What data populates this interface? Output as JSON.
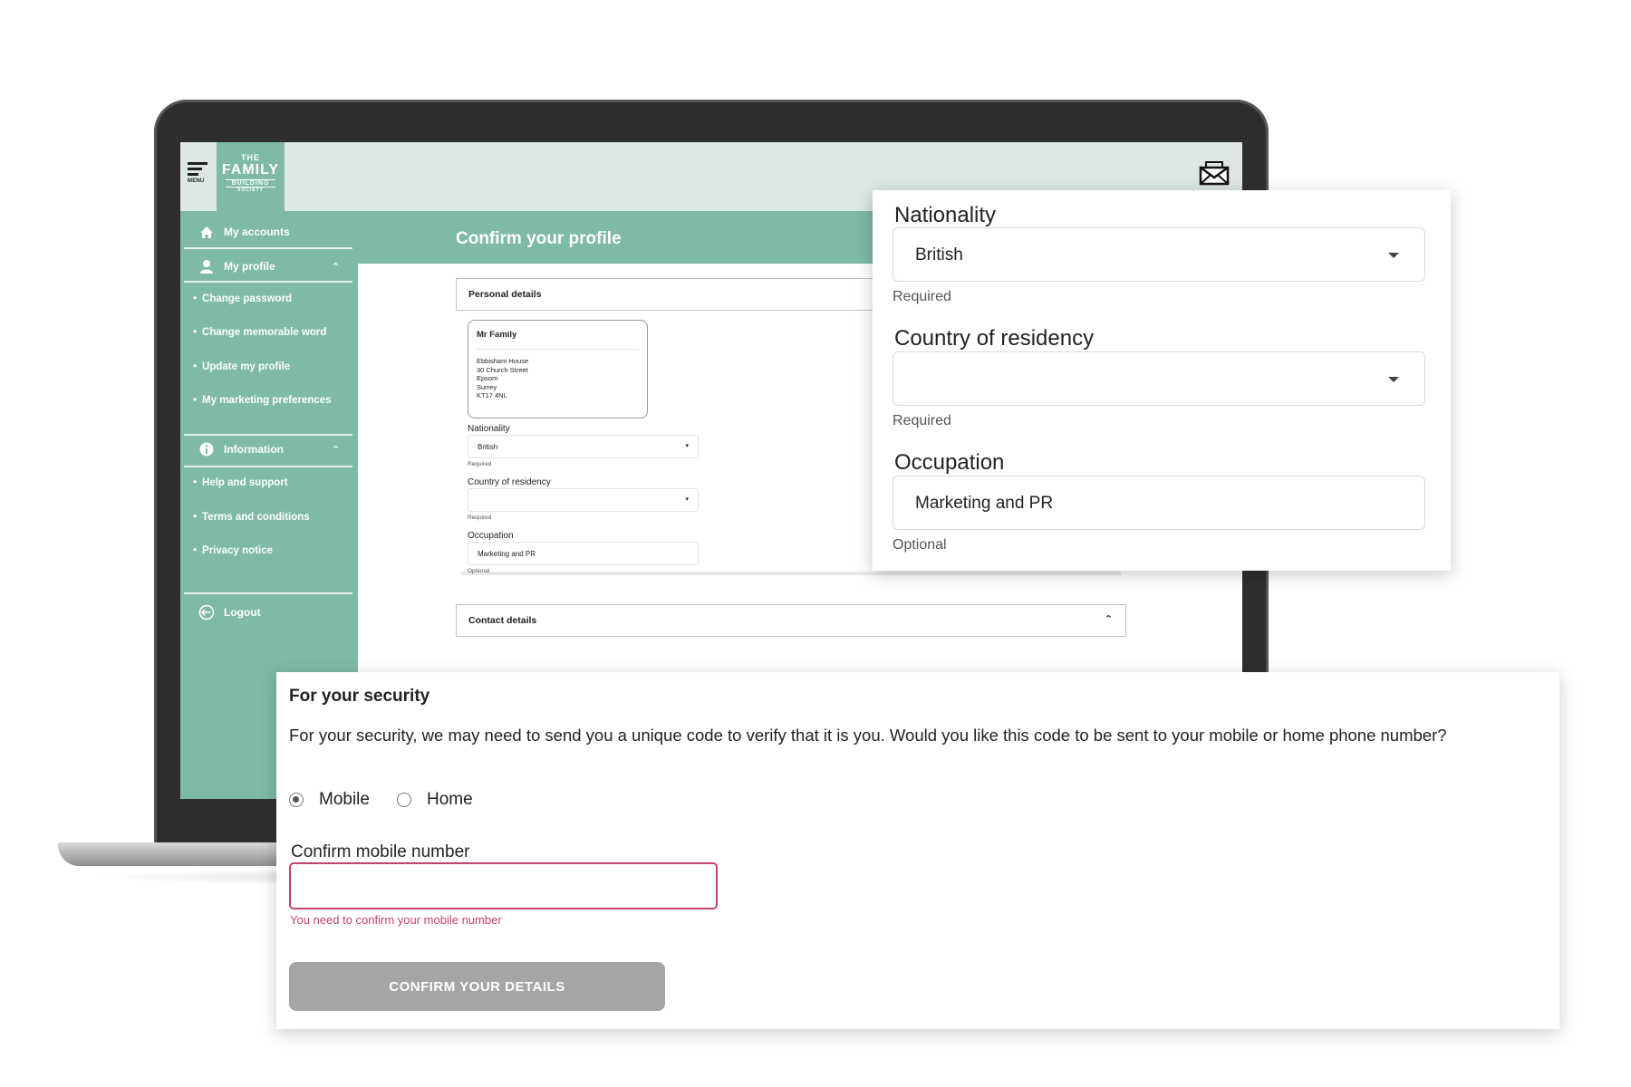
{
  "brand": {
    "menu_label": "MENU",
    "logo_line1": "THE",
    "logo_line2": "FAMILY",
    "logo_line3": "BUILDING",
    "logo_line4": "SOCIETY",
    "accent_color": "#7ebaa5",
    "topbar_color": "#dde7e5"
  },
  "sidebar": {
    "my_accounts": "My accounts",
    "my_profile": "My profile",
    "profile_items": [
      "Change password",
      "Change memorable word",
      "Update my profile",
      "My marketing preferences"
    ],
    "information": "Information",
    "information_items": [
      "Help and support",
      "Terms and conditions",
      "Privacy notice"
    ],
    "logout": "Logout"
  },
  "page": {
    "title": "Confirm your profile",
    "personal_details": "Personal details",
    "contact_details": "Contact details",
    "address_card": {
      "name": "Mr Family",
      "lines": [
        "Ebbisham House",
        "30 Church Street",
        "Epsom",
        "Surrey",
        "KT17 4NL"
      ]
    },
    "nationality_label": "Nationality",
    "nationality_value": "British",
    "nationality_hint": "Required",
    "residency_label": "Country of residency",
    "residency_value": "",
    "residency_hint": "Required",
    "occupation_label": "Occupation",
    "occupation_value": "Marketing and PR",
    "occupation_hint": "Optional"
  },
  "detail_card": {
    "nationality_label": "Nationality",
    "nationality_value": "British",
    "nationality_hint": "Required",
    "residency_label": "Country of residency",
    "residency_value": "",
    "residency_hint": "Required",
    "occupation_label": "Occupation",
    "occupation_value": "Marketing and PR",
    "occupation_hint": "Optional"
  },
  "security": {
    "title": "For your security",
    "text": "For your security, we may need to send you a unique code to verify that it is you. Would you like this code to be sent to your mobile or home phone number?",
    "option_mobile": "Mobile",
    "option_home": "Home",
    "selected_option": "Mobile",
    "confirm_label": "Confirm mobile number",
    "confirm_value": "",
    "error": "You need to confirm your mobile number",
    "error_color": "#c44173",
    "button": "CONFIRM YOUR DETAILS"
  }
}
